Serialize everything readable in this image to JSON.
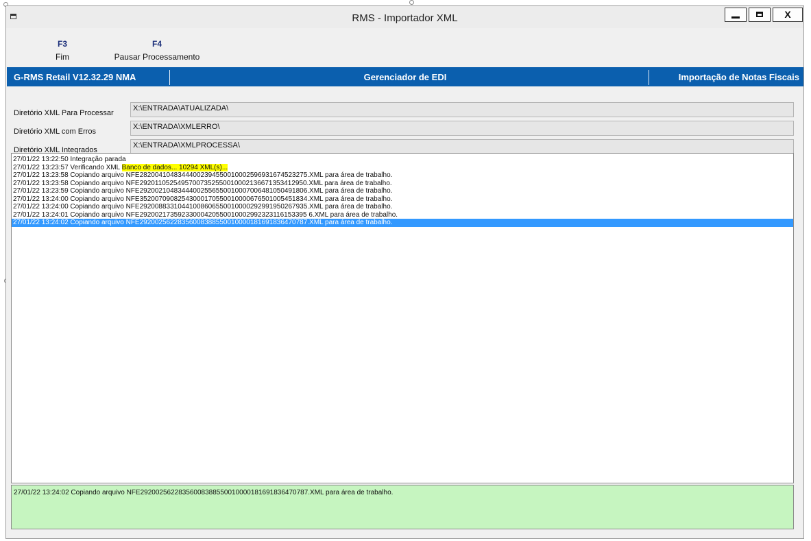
{
  "window": {
    "title": "RMS - Importador XML",
    "minimize": "minimize-icon",
    "maximize": "maximize-icon",
    "close_label": "X"
  },
  "toolbar": {
    "f3_key": "F3",
    "f3_label": "Fim",
    "f4_key": "F4",
    "f4_label": "Pausar Processamento"
  },
  "header": {
    "left": "G-RMS Retail V12.32.29 NMA",
    "center": "Gerenciador de EDI",
    "right": "Importação de Notas Fiscais"
  },
  "directories": [
    {
      "label": "Diretório XML Para Processar",
      "value": "X:\\ENTRADA\\ATUALIZADA\\"
    },
    {
      "label": "Diretório XML com Erros",
      "value": "X:\\ENTRADA\\XMLERRO\\"
    },
    {
      "label": "Diretório XML Integrados",
      "value": "X:\\ENTRADA\\XMLPROCESSA\\"
    }
  ],
  "log": {
    "line0": "27/01/22 13:22:50 Integração parada",
    "line1_prefix": "27/01/22 13:23:57 Verificando XML ",
    "line1_highlight": "Banco de dados... 10294 XML(s)...",
    "lines": [
      "27/01/22 13:23:58 Copiando arquivo NFE28200410483444002394550010002596931674523275.XML para área de trabalho.",
      "27/01/22 13:23:58 Copiando arquivo NFE29201105254957007352550010002136671353412950.XML para área de trabalho.",
      "27/01/22 13:23:59 Copiando arquivo NFE29200210483444002556550010007006481050491806.XML para área de trabalho.",
      "27/01/22 13:24:00 Copiando arquivo NFE35200709082543000170550010000676501005451834.XML para área de trabalho.",
      "27/01/22 13:24:00 Copiando arquivo NFE29200883310441008606550010000292991950267935.XML para área de trabalho.",
      "27/01/22 13:24:01 Copiando arquivo NFE29200217359233000420550010002992323116153395 6.XML para área de trabalho."
    ],
    "selected": "27/01/22 13:24:02 Copiando arquivo NFE29200256228356008388550010000181691836470787.XML para área de trabalho."
  },
  "status": {
    "text": "27/01/22 13:24:02 Copiando arquivo NFE29200256228356008388550010000181691836470787.XML para área de trabalho."
  },
  "colors": {
    "header_bg": "#0b5fae",
    "status_bg": "#c6f5c0",
    "selection": "#3399ff",
    "highlight": "#ffff00"
  }
}
